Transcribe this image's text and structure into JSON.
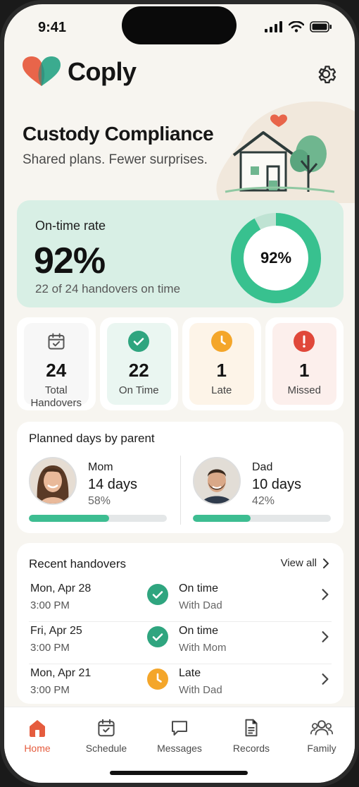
{
  "status_bar": {
    "time": "9:41"
  },
  "header": {
    "app_name": "Coply",
    "settings_icon": "gear-icon"
  },
  "hero": {
    "title": "Custody Compliance",
    "subtitle": "Shared plans. Fewer surprises."
  },
  "on_time": {
    "label": "On-time rate",
    "rate": "92%",
    "rate_value": 0.92,
    "summary": "22 of 24 handovers on time",
    "donut_label": "92%"
  },
  "stats": [
    {
      "value": "24",
      "label": "Total Handovers",
      "icon": "calendar-check-icon",
      "color": "#6d6d6d"
    },
    {
      "value": "22",
      "label": "On Time",
      "icon": "check-circle-icon",
      "color": "#2fa57f"
    },
    {
      "value": "1",
      "label": "Late",
      "icon": "clock-icon",
      "color": "#f4a62a"
    },
    {
      "value": "1",
      "label": "Missed",
      "icon": "alert-circle-icon",
      "color": "#e0483a"
    }
  ],
  "planned": {
    "title": "Planned days by parent",
    "parents": [
      {
        "name": "Mom",
        "days": "14 days",
        "percent": "58%",
        "fraction": 0.58
      },
      {
        "name": "Dad",
        "days": "10 days",
        "percent": "42%",
        "fraction": 0.42
      }
    ]
  },
  "recent": {
    "title": "Recent handovers",
    "view_all": "View all",
    "rows": [
      {
        "date": "Mon, Apr 28",
        "time": "3:00 PM",
        "status": "On time",
        "with": "With Dad",
        "icon": "check-circle-icon"
      },
      {
        "date": "Fri, Apr 25",
        "time": "3:00 PM",
        "status": "On time",
        "with": "With Mom",
        "icon": "check-circle-icon"
      },
      {
        "date": "Mon, Apr 21",
        "time": "3:00 PM",
        "status": "Late",
        "with": "With Dad",
        "icon": "clock-icon"
      }
    ]
  },
  "tabs": [
    {
      "label": "Home",
      "icon": "home-icon",
      "active": true
    },
    {
      "label": "Schedule",
      "icon": "calendar-icon",
      "active": false
    },
    {
      "label": "Messages",
      "icon": "chat-icon",
      "active": false
    },
    {
      "label": "Records",
      "icon": "document-icon",
      "active": false
    },
    {
      "label": "Family",
      "icon": "people-icon",
      "active": false
    }
  ],
  "colors": {
    "accent_green": "#3dbd91",
    "brand_orange": "#e55c3e",
    "late_orange": "#f4a62a",
    "missed_red": "#e0483a"
  }
}
